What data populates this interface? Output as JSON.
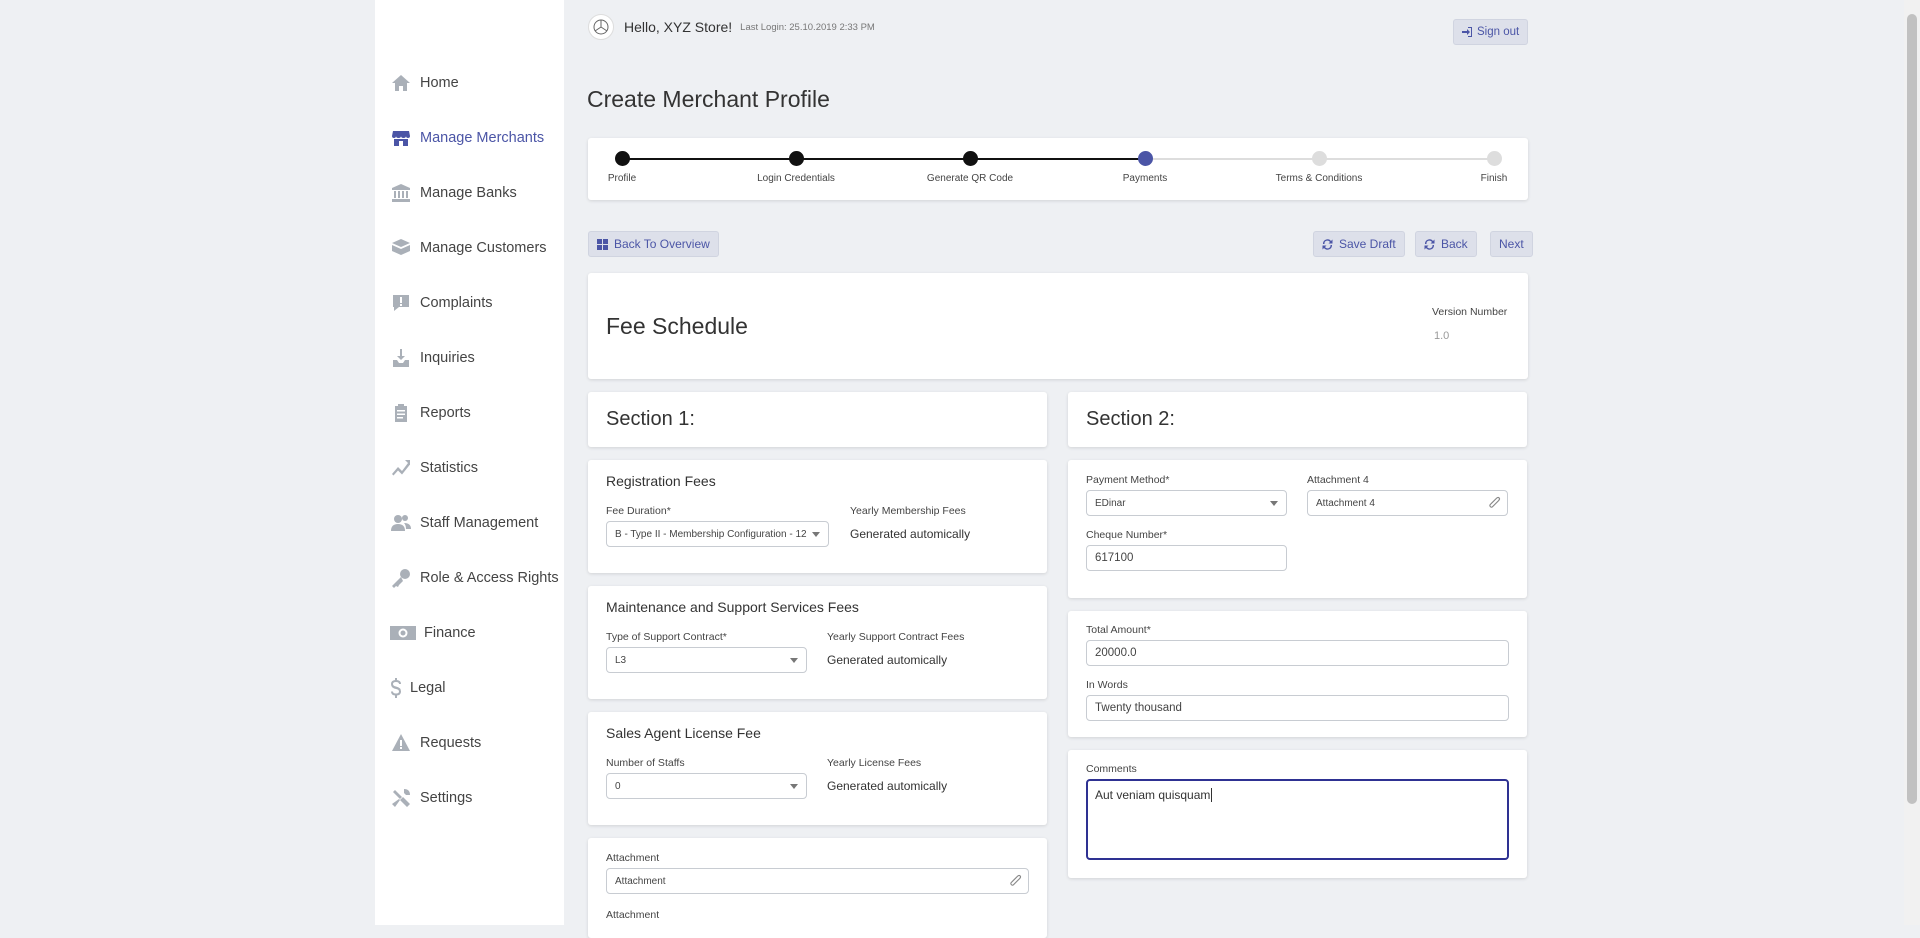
{
  "sidebar": {
    "items": [
      {
        "label": "Home",
        "icon": "home-icon"
      },
      {
        "label": "Manage Merchants",
        "icon": "store-icon"
      },
      {
        "label": "Manage Banks",
        "icon": "bank-icon"
      },
      {
        "label": "Manage Customers",
        "icon": "customers-icon"
      },
      {
        "label": "Complaints",
        "icon": "complaint-icon"
      },
      {
        "label": "Inquiries",
        "icon": "inquiry-icon"
      },
      {
        "label": "Reports",
        "icon": "report-icon"
      },
      {
        "label": "Statistics",
        "icon": "chart-icon"
      },
      {
        "label": "Staff Management",
        "icon": "staff-icon"
      },
      {
        "label": "Role & Access Rights",
        "icon": "key-icon"
      },
      {
        "label": "Finance",
        "icon": "money-icon"
      },
      {
        "label": "Legal",
        "icon": "dollar-icon"
      },
      {
        "label": "Requests",
        "icon": "warning-icon"
      },
      {
        "label": "Settings",
        "icon": "tools-icon"
      }
    ],
    "active": "Manage Merchants",
    "accent": "#4b55a6"
  },
  "header": {
    "greeting": "Hello, XYZ Store!",
    "last_login": "Last Login: 25.10.2019 2:33 PM",
    "signout_label": "Sign out"
  },
  "page_title": "Create Merchant Profile",
  "stepper": {
    "steps": [
      "Profile",
      "Login Credentials",
      "Generate QR Code",
      "Payments",
      "Terms & Conditions",
      "Finish"
    ],
    "current_step": "Payments"
  },
  "actions": {
    "back_overview": "Back To Overview",
    "save_draft": "Save Draft",
    "back": "Back",
    "next": "Next"
  },
  "fee_schedule": {
    "title": "Fee Schedule",
    "version_label": "Version Number",
    "version_value": "1.0"
  },
  "section1": {
    "title": "Section 1:",
    "registration": {
      "title": "Registration Fees",
      "fee_duration_label": "Fee Duration*",
      "fee_duration_value": "B - Type II - Membership Configuration - 12",
      "yearly_label": "Yearly Membership Fees",
      "yearly_value": "Generated automically"
    },
    "maintenance": {
      "title": "Maintenance and Support Services Fees",
      "contract_label": "Type of Support Contract*",
      "contract_value": "L3",
      "yearly_label": "Yearly Support Contract Fees",
      "yearly_value": "Generated automically"
    },
    "sales_agent": {
      "title": "Sales Agent License Fee",
      "staffs_label": "Number of Staffs",
      "staffs_value": "0",
      "yearly_label": "Yearly License Fees",
      "yearly_value": "Generated automically"
    },
    "attachments": {
      "label1": "Attachment",
      "placeholder1": "Attachment",
      "label2": "Attachment"
    }
  },
  "section2": {
    "title": "Section 2:",
    "payment_method_label": "Payment Method*",
    "payment_method_value": "EDinar",
    "attachment4_label": "Attachment 4",
    "attachment4_placeholder": "Attachment 4",
    "cheque_label": "Cheque Number*",
    "cheque_value": "617100",
    "total_label": "Total Amount*",
    "total_value": "20000.0",
    "words_label": "In Words",
    "words_value": "Twenty thousand",
    "comments_label": "Comments",
    "comments_value": "Aut veniam quisquam"
  },
  "colors": {
    "step_done": "#111111",
    "step_current": "#4b55a6",
    "step_pending": "#dddddd",
    "focus_border": "#2e3192"
  }
}
